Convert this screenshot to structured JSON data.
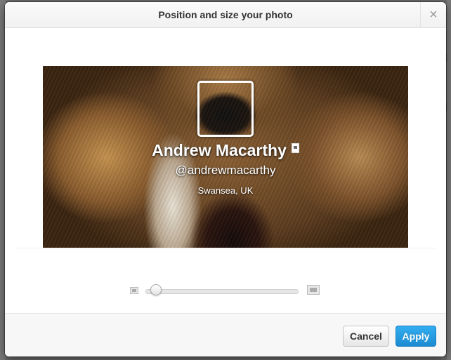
{
  "dialog": {
    "title": "Position and size your photo",
    "close_glyph": "×"
  },
  "profile": {
    "name": "Andrew Macarthy",
    "handle": "@andrewmacarthy",
    "location": "Swansea, UK"
  },
  "zoom": {
    "level_fraction": 0.0
  },
  "buttons": {
    "cancel": "Cancel",
    "apply": "Apply"
  },
  "colors": {
    "accent": "#1c8bd1"
  }
}
